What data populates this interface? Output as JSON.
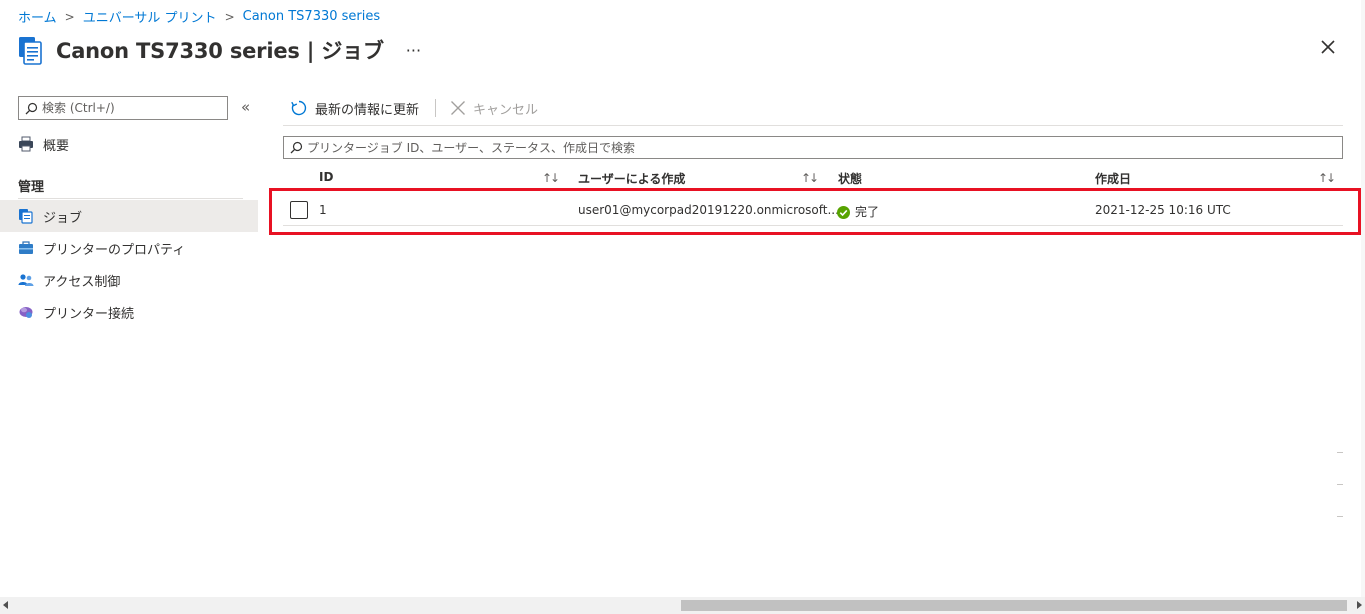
{
  "breadcrumb": {
    "items": [
      "ホーム",
      "ユニバーサル プリント",
      "Canon TS7330 series"
    ],
    "separator": ">"
  },
  "header": {
    "title": "Canon TS7330 series | ジョブ",
    "more_label": "···",
    "close_icon": "close-icon"
  },
  "sidebar": {
    "search_placeholder": "検索 (Ctrl+/)",
    "collapse_label": "«",
    "overview_label": "概要",
    "section_label": "管理",
    "items": [
      {
        "label": "ジョブ",
        "icon": "jobs-icon",
        "active": true
      },
      {
        "label": "プリンターのプロパティ",
        "icon": "printer-properties-icon",
        "active": false
      },
      {
        "label": "アクセス制御",
        "icon": "access-control-icon",
        "active": false
      },
      {
        "label": "プリンター接続",
        "icon": "printer-connection-icon",
        "active": false
      }
    ]
  },
  "toolbar": {
    "refresh_label": "最新の情報に更新",
    "cancel_label": "キャンセル"
  },
  "filter": {
    "placeholder": "プリンタージョブ ID、ユーザー、ステータス、作成日で検索"
  },
  "table": {
    "columns": [
      "ID",
      "ユーザーによる作成",
      "状態",
      "作成日"
    ],
    "rows": [
      {
        "id": "1",
        "user": "user01@mycorpad20191220.onmicrosoft....",
        "status": "完了",
        "created": "2021-12-25 10:16 UTC"
      }
    ]
  },
  "colors": {
    "accent": "#0078d4",
    "highlight": "#e81123",
    "success": "#57a300"
  }
}
